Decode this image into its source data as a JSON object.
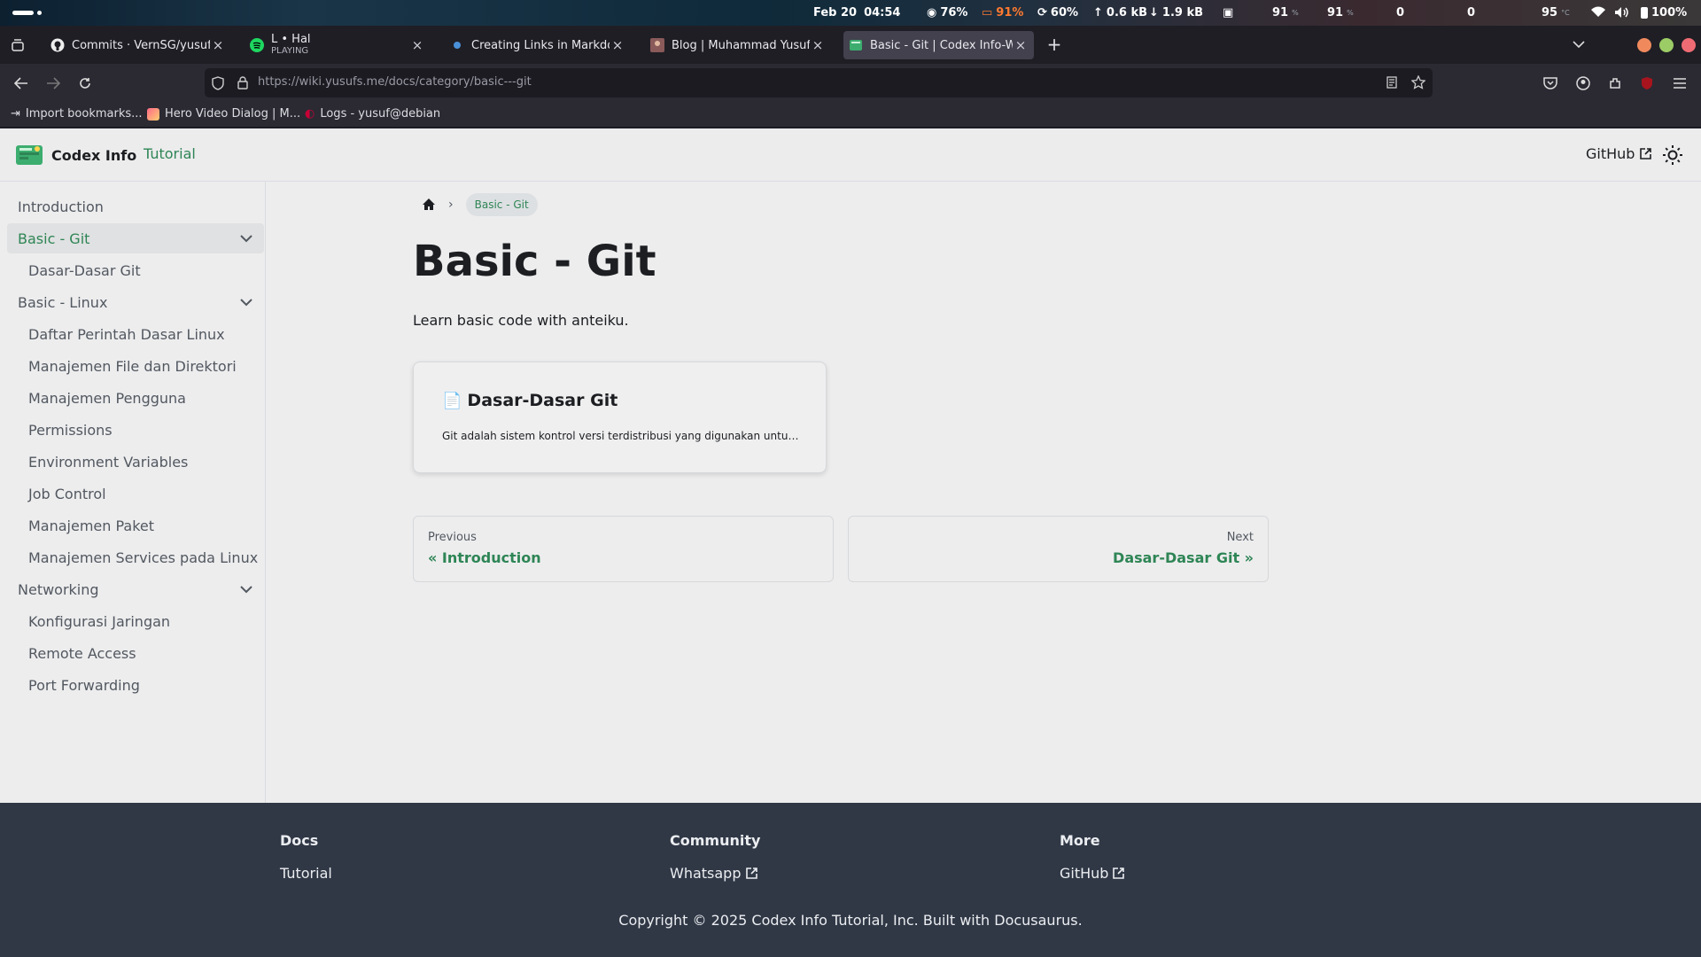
{
  "system_bar": {
    "date": "Feb 20",
    "time": "04:54",
    "cpu": "76%",
    "gpu": "91%",
    "disk": "60%",
    "upload": "0.6 kB",
    "download": "1.9 kB",
    "val1": "91",
    "val2": "91",
    "net_a": "0",
    "net_b": "0",
    "temp": "95",
    "battery": "100%"
  },
  "tabs": [
    {
      "title": "Commits · VernSG/yusufpor",
      "subtitle": ""
    },
    {
      "title": "L • Hal",
      "subtitle": "PLAYING"
    },
    {
      "title": "Creating Links in Markdown",
      "subtitle": ""
    },
    {
      "title": "Blog | Muhammad Yusuf",
      "subtitle": ""
    },
    {
      "title": "Basic - Git | Codex Info-Wiki",
      "subtitle": ""
    }
  ],
  "address": {
    "url": "https://wiki.yusufs.me/docs/category/basic---git"
  },
  "bookmarks": [
    "Import bookmarks...",
    "Hero Video Dialog | M...",
    "Logs - yusuf@debian"
  ],
  "site": {
    "brand": "Codex Info",
    "nav_tutorial": "Tutorial",
    "github": "GitHub"
  },
  "sidebar": {
    "items": [
      {
        "label": "Introduction"
      },
      {
        "label": "Basic - Git"
      },
      {
        "label": "Dasar-Dasar Git"
      },
      {
        "label": "Basic - Linux"
      },
      {
        "label": "Daftar Perintah Dasar Linux"
      },
      {
        "label": "Manajemen File dan Direktori"
      },
      {
        "label": "Manajemen Pengguna"
      },
      {
        "label": "Permissions"
      },
      {
        "label": "Environment Variables"
      },
      {
        "label": "Job Control"
      },
      {
        "label": "Manajemen Paket"
      },
      {
        "label": "Manajemen Services pada Linux"
      },
      {
        "label": "Networking"
      },
      {
        "label": "Konfigurasi Jaringan"
      },
      {
        "label": "Remote Access"
      },
      {
        "label": "Port Forwarding"
      }
    ]
  },
  "main": {
    "breadcrumb": "Basic - Git",
    "title": "Basic - Git",
    "description": "Learn basic code with anteiku.",
    "card": {
      "title": "Dasar-Dasar Git",
      "description": "Git adalah sistem kontrol versi terdistribusi yang digunakan untuk mengelola perubahan kode"
    },
    "prev": {
      "sub": "Previous",
      "label": "« Introduction"
    },
    "next": {
      "sub": "Next",
      "label": "Dasar-Dasar Git »"
    }
  },
  "footer": {
    "docs": {
      "heading": "Docs",
      "link": "Tutorial"
    },
    "community": {
      "heading": "Community",
      "link": "Whatsapp"
    },
    "more": {
      "heading": "More",
      "link": "GitHub"
    },
    "copyright": "Copyright © 2025 Codex Info Tutorial, Inc. Built with Docusaurus."
  },
  "colors": {
    "accent": "#2e8555",
    "footer_bg": "#303846",
    "browser_chrome": "#2b2a33"
  }
}
